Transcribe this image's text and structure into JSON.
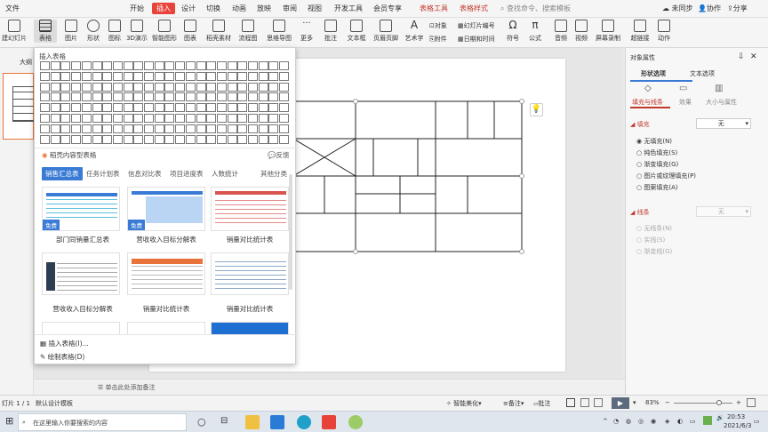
{
  "tabs": {
    "file": "文件",
    "start": "开始",
    "insert": "插入",
    "design": "设计",
    "switch": "切换",
    "animation": "动画",
    "slideshow": "放映",
    "review": "审阅",
    "view": "视图",
    "devtools": "开发工具",
    "member": "会员专享",
    "table_tools": "表格工具",
    "table_style": "表格样式",
    "search": "查找命令、搜索模板",
    "sync": "未同步",
    "collab": "协作",
    "share": "分享"
  },
  "ribbon": {
    "new_slide": "建幻灯片",
    "table": "表格",
    "picture": "图片",
    "shape": "形状",
    "icon": "图标",
    "3d": "3D演示",
    "smart_graphic": "智能图形",
    "chart": "图表",
    "daoke": "稻壳素材",
    "flowchart": "流程图",
    "mindmap": "思维导图",
    "more": "更多",
    "comment": "批注",
    "textbox": "文本框",
    "header_footer": "页眉页脚",
    "art_text": "艺术字",
    "object": "对象",
    "attachment": "附件",
    "slide_number": "幻灯片编号",
    "date_time": "日期和时间",
    "symbol": "符号",
    "formula": "公式",
    "audio": "音频",
    "video": "视频",
    "screen_record": "屏幕录制",
    "hyperlink": "超链接",
    "action": "动作"
  },
  "left_panel": {
    "title": "大纲"
  },
  "dropdown": {
    "title": "插入表格",
    "daoke_title": "稻壳内容型表格",
    "feedback": "反馈",
    "categories": [
      "销售汇总表",
      "任务计划表",
      "信息对比表",
      "项目进度表",
      "人数统计",
      "其他分类"
    ],
    "free_badge": "免费",
    "templates": [
      {
        "label": "部门同销量汇总表"
      },
      {
        "label": "营收收入目标分解表"
      },
      {
        "label": "销量对比统计表"
      },
      {
        "label": "营收收入目标分解表"
      },
      {
        "label": "销量对比统计表"
      },
      {
        "label": "销量对比统计表"
      }
    ],
    "insert_table": "插入表格(I)...",
    "draw_table": "绘制表格(D)"
  },
  "right_panel": {
    "title": "对象属性",
    "tab_shape": "形状选项",
    "tab_text": "文本选项",
    "sub_fill": "填充与线条",
    "sub_effect": "效果",
    "sub_size": "大小与属性",
    "fill_label": "填充",
    "fill_value": "无",
    "fill_options": [
      "无填充(N)",
      "纯色填充(S)",
      "渐变填充(G)",
      "图片或纹理填充(P)",
      "图案填充(A)"
    ],
    "line_label": "线条",
    "line_value": "无",
    "line_options": [
      "无线条(N)",
      "实线(S)",
      "渐变线(G)"
    ]
  },
  "notes": {
    "placeholder": "单击此处添加备注"
  },
  "status": {
    "slide": "灯片 1 / 1",
    "template": "默认设计模板",
    "beautify": "智能美化",
    "notes": "备注",
    "comment": "批注",
    "zoom": "83%"
  },
  "taskbar": {
    "search": "在这里输入你要搜索的内容",
    "time": "20:53",
    "date": "2021/6/3"
  }
}
